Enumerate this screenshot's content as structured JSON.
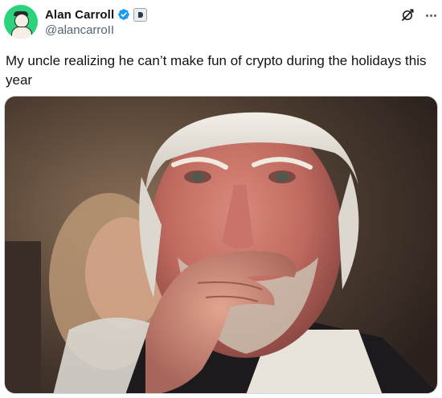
{
  "author": {
    "display_name": "Alan Carroll",
    "handle": "@alancarroII",
    "verified": true,
    "affiliation_badge": "square-badge-icon",
    "avatar": "avatar-icon"
  },
  "tweet": {
    "text": "My uncle realizing he can’t make fun of crypto during the holidays this year"
  },
  "actions": {
    "grok_icon": "grok-icon",
    "more_icon": "more-options-icon"
  },
  "colors": {
    "verified_blue": "#1d9bf0",
    "secondary_text": "#536471",
    "avatar_green": "#2bd47a"
  },
  "media": {
    "type": "image",
    "alt_subject": "crying-old-man-photo"
  }
}
